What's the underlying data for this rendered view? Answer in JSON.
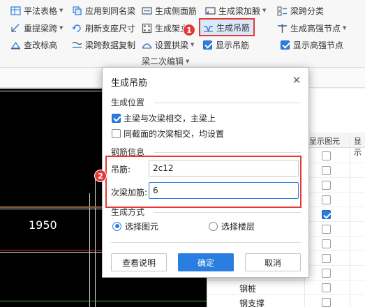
{
  "ribbon": {
    "row1": [
      {
        "label": "平法表格",
        "icon": "table-icon",
        "dropdown": true
      },
      {
        "label": "应用到同名梁",
        "icon": "copy-beam-icon",
        "dropdown": false
      },
      {
        "label": "生成侧面筋",
        "icon": "side-rebar-icon",
        "dropdown": false
      },
      {
        "label": "生成梁加腋",
        "icon": "haunch-icon",
        "dropdown": true
      },
      {
        "label": "梁跨分类",
        "icon": "span-category-icon",
        "dropdown": false
      }
    ],
    "row2": [
      {
        "label": "重提梁跨",
        "icon": "reextract-span-icon",
        "dropdown": true
      },
      {
        "label": "刷新支座尺寸",
        "icon": "refresh-support-icon",
        "dropdown": false
      },
      {
        "label": "生成架立",
        "icon": "erection-bar-icon",
        "dropdown": false
      },
      {
        "label": "生成吊筋",
        "icon": "hanger-bar-icon",
        "dropdown": false
      },
      {
        "label": "生成高强节点",
        "icon": "high-strength-node-icon",
        "dropdown": true
      }
    ],
    "row3": [
      {
        "label": "查改标高",
        "icon": "elevation-icon",
        "dropdown": false
      },
      {
        "label": "梁跨数据复制",
        "icon": "span-data-copy-icon",
        "dropdown": false
      },
      {
        "label": "设置拱梁",
        "icon": "arch-beam-icon",
        "dropdown": true
      },
      {
        "label": "显示吊筋",
        "checked": true
      },
      {
        "label": "显示高强节点",
        "checked": true
      }
    ],
    "group_label": "梁二次编辑",
    "badge1": "1"
  },
  "canvas": {
    "dimension": "1950"
  },
  "panel": {
    "col_header_show": "显示图元",
    "col_header_show2": "显示",
    "rows": [
      {
        "label": "",
        "checked": false
      },
      {
        "label": "",
        "checked": false
      },
      {
        "label": "",
        "checked": false
      },
      {
        "label": "",
        "checked": false
      },
      {
        "label": "",
        "checked": false
      },
      {
        "label": "",
        "checked": true
      },
      {
        "label": "",
        "checked": false
      },
      {
        "label": "",
        "checked": false
      },
      {
        "label": "",
        "checked": false
      },
      {
        "label": "",
        "checked": false
      },
      {
        "label": "钢桩",
        "checked": false
      },
      {
        "label": "钢支撑",
        "checked": false
      }
    ]
  },
  "dialog": {
    "title": "生成吊筋",
    "section_position": "生成位置",
    "opt_main_secondary": "主梁与次梁相交，主梁上",
    "opt_same_section": "同截面的次梁相交，均设置",
    "section_rebar": "钢筋信息",
    "hanger_label": "吊筋:",
    "hanger_value": "2c12",
    "secondary_label": "次梁加筋:",
    "secondary_value": "6",
    "section_mode": "生成方式",
    "radio_select_element": "选择图元",
    "radio_select_floor": "选择楼层",
    "btn_help": "查看说明",
    "btn_ok": "确定",
    "btn_cancel": "取消",
    "badge2": "2"
  }
}
